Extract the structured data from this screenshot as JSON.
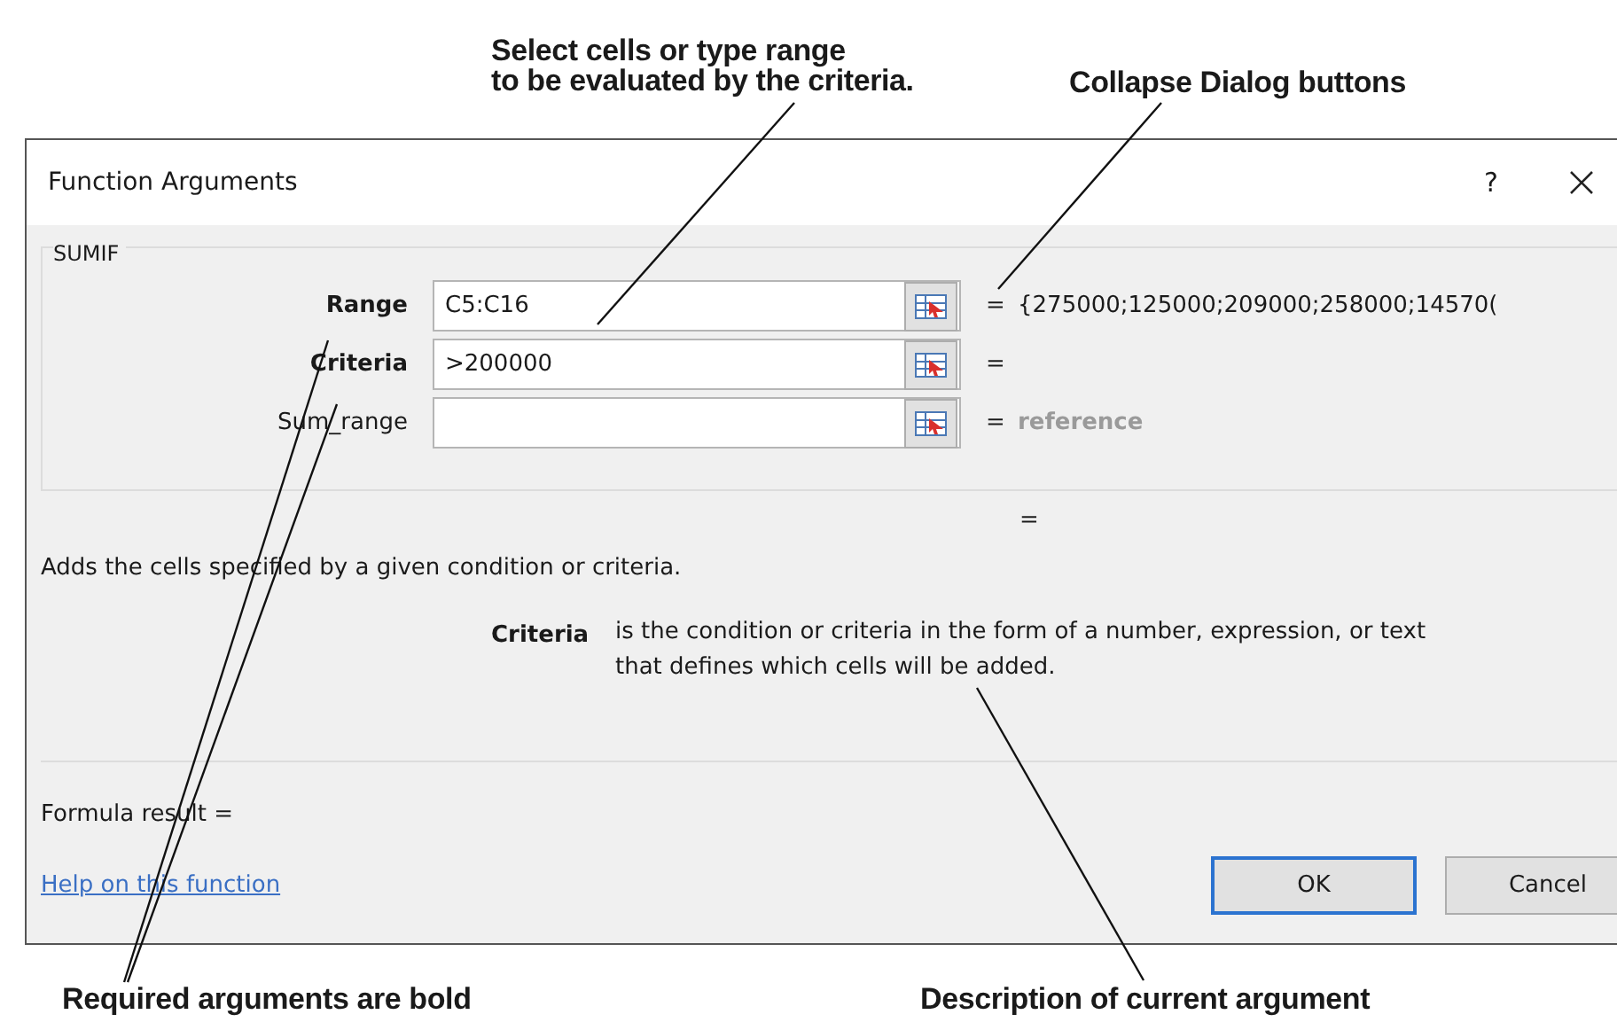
{
  "callouts_top": [
    {
      "text": "Select cells or type range\nto be evaluated by the criteria."
    },
    {
      "text": "Collapse Dialog buttons"
    }
  ],
  "dialog": {
    "title": "Function Arguments",
    "help": "?",
    "function_name": "SUMIF",
    "arguments": [
      {
        "label": "Range",
        "value": "C5:C16",
        "required": true,
        "result": "{275000;125000;209000;258000;14570(",
        "result_muted": false
      },
      {
        "label": "Criteria",
        "value": ">200000",
        "required": true
      },
      {
        "label": "Sum_range",
        "required": false,
        "result": "reference",
        "result_muted": true
      }
    ],
    "equals": "=",
    "overall_equals": "=",
    "description": "Adds the cells specified by a given condition or criteria.",
    "current_argument": {
      "name": "Criteria",
      "text": "is the condition or criteria in the form of a number, expression, or text\nthat defines which cells will be added."
    },
    "formula_result": "Formula result =",
    "help_link": "Help on this function",
    "buttons": [
      {
        "label": "OK",
        "default": true
      },
      {
        "label": "Cancel",
        "default": false
      }
    ]
  },
  "callouts_bottom": [
    {
      "text": "Required arguments are bold"
    },
    {
      "text": "Description of current argument"
    }
  ]
}
